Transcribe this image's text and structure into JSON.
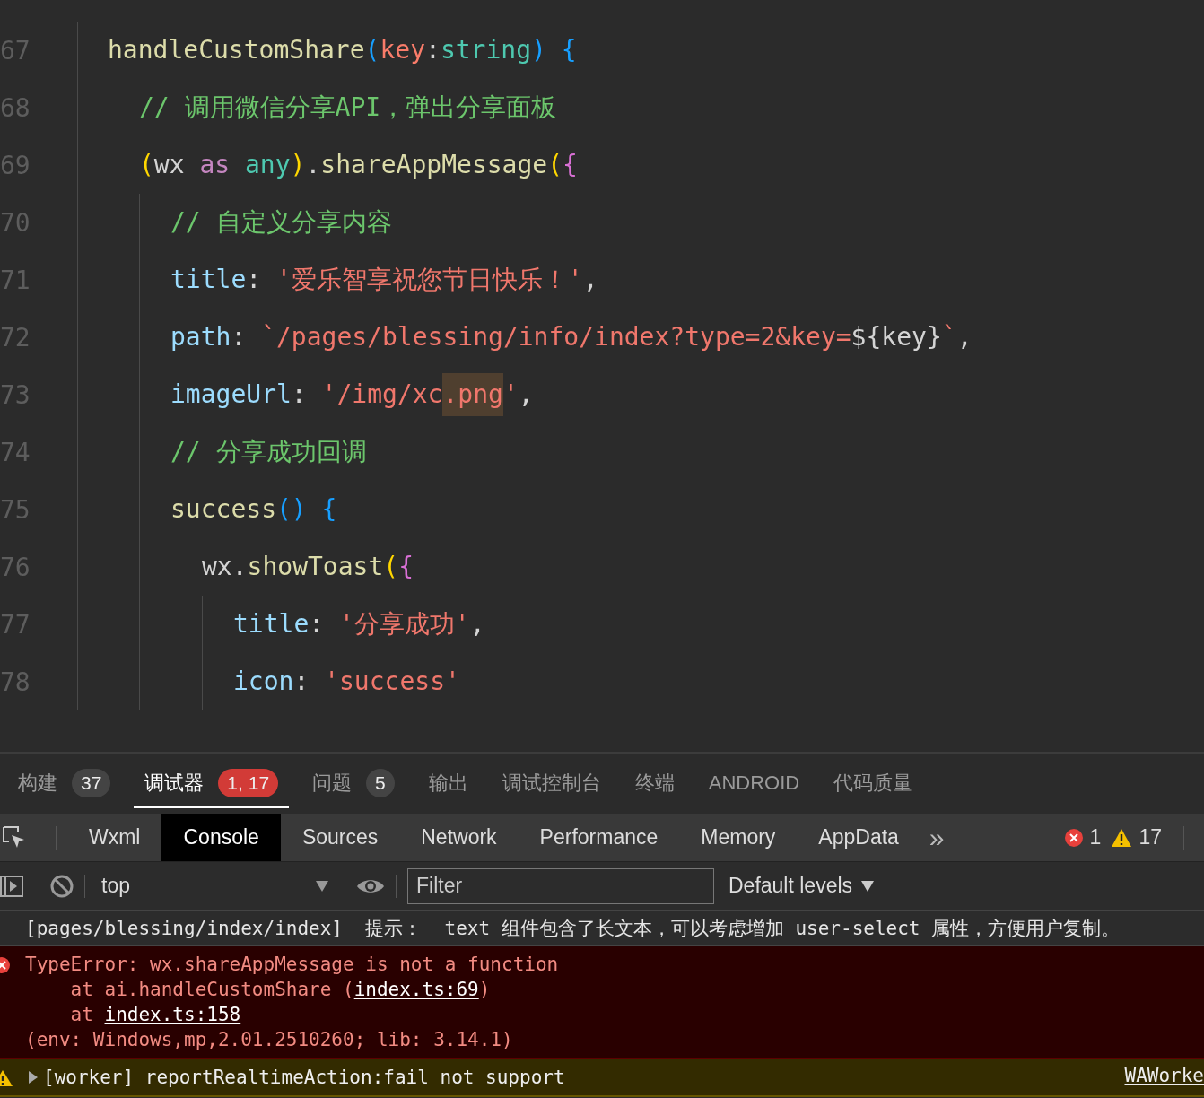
{
  "editor": {
    "lines": [
      {
        "number": "67",
        "tokens": [
          {
            "text": "handleCustomShare",
            "kind": "fn"
          },
          {
            "text": "(",
            "kind": "bracket3"
          },
          {
            "text": "key",
            "kind": "param"
          },
          {
            "text": ":",
            "kind": "plain"
          },
          {
            "text": "string",
            "kind": "type"
          },
          {
            "text": ")",
            "kind": "bracket3"
          },
          {
            "text": " {",
            "kind": "bracket3"
          }
        ],
        "children": [
          {
            "number": "68",
            "tokens": [
              {
                "text": "// 调用微信分享API，弹出分享面板",
                "kind": "comment"
              }
            ]
          },
          {
            "number": "69",
            "tokens": [
              {
                "text": "(",
                "kind": "bracket1"
              },
              {
                "text": "wx ",
                "kind": "plain"
              },
              {
                "text": "as",
                "kind": "keyword"
              },
              {
                "text": " any",
                "kind": "type"
              },
              {
                "text": ")",
                "kind": "bracket1"
              },
              {
                "text": ".",
                "kind": "plain"
              },
              {
                "text": "shareAppMessage",
                "kind": "fn"
              },
              {
                "text": "(",
                "kind": "bracket1"
              },
              {
                "text": "{",
                "kind": "bracket2"
              }
            ],
            "children": [
              {
                "number": "70",
                "tokens": [
                  {
                    "text": "// 自定义分享内容",
                    "kind": "comment"
                  }
                ]
              },
              {
                "number": "71",
                "tokens": [
                  {
                    "text": "title",
                    "kind": "prop"
                  },
                  {
                    "text": ": ",
                    "kind": "plain"
                  },
                  {
                    "text": "'爱乐智享祝您节日快乐！'",
                    "kind": "str"
                  },
                  {
                    "text": ",",
                    "kind": "plain"
                  }
                ]
              },
              {
                "number": "72",
                "tokens": [
                  {
                    "text": "path",
                    "kind": "prop"
                  },
                  {
                    "text": ": ",
                    "kind": "plain"
                  },
                  {
                    "text": "`/pages/blessing/info/index?type=2&key=",
                    "kind": "str"
                  },
                  {
                    "text": "${key}",
                    "kind": "plain"
                  },
                  {
                    "text": "`",
                    "kind": "str"
                  },
                  {
                    "text": ",",
                    "kind": "plain"
                  }
                ]
              },
              {
                "number": "73",
                "tokens": [
                  {
                    "text": "imageUrl",
                    "kind": "prop"
                  },
                  {
                    "text": ": ",
                    "kind": "plain"
                  },
                  {
                    "text": "'/img/xc",
                    "kind": "str"
                  },
                  {
                    "text": ".png",
                    "kind": "match"
                  },
                  {
                    "text": "'",
                    "kind": "str"
                  },
                  {
                    "text": ",",
                    "kind": "plain"
                  }
                ]
              },
              {
                "number": "74",
                "tokens": [
                  {
                    "text": "// 分享成功回调",
                    "kind": "comment"
                  }
                ]
              },
              {
                "number": "75",
                "tokens": [
                  {
                    "text": "success",
                    "kind": "fn"
                  },
                  {
                    "text": "()",
                    "kind": "bracket3"
                  },
                  {
                    "text": " {",
                    "kind": "bracket3"
                  }
                ],
                "children": [
                  {
                    "number": "76",
                    "tokens": [
                      {
                        "text": "wx.",
                        "kind": "plain"
                      },
                      {
                        "text": "showToast",
                        "kind": "fn"
                      },
                      {
                        "text": "(",
                        "kind": "bracket1"
                      },
                      {
                        "text": "{",
                        "kind": "bracket2"
                      }
                    ],
                    "children": [
                      {
                        "number": "77",
                        "tokens": [
                          {
                            "text": "title",
                            "kind": "prop"
                          },
                          {
                            "text": ": ",
                            "kind": "plain"
                          },
                          {
                            "text": "'分享成功'",
                            "kind": "str"
                          },
                          {
                            "text": ",",
                            "kind": "plain"
                          }
                        ]
                      },
                      {
                        "number": "78",
                        "tokens": [
                          {
                            "text": "icon",
                            "kind": "prop"
                          },
                          {
                            "text": ": ",
                            "kind": "plain"
                          },
                          {
                            "text": "'success'",
                            "kind": "str"
                          }
                        ]
                      }
                    ]
                  }
                ]
              }
            ]
          }
        ]
      }
    ]
  },
  "panel_tabs": [
    {
      "label": "构建",
      "badge": "37",
      "color": "#444444",
      "selected": false
    },
    {
      "label": "调试器",
      "badge": "1, 17",
      "color": "#d23b37",
      "selected": true
    },
    {
      "label": "问题",
      "badge": "5",
      "color": "#444444",
      "selected": false
    },
    {
      "label": "输出",
      "selected": false
    },
    {
      "label": "调试控制台",
      "selected": false
    },
    {
      "label": "终端",
      "selected": false
    },
    {
      "label": "ANDROID",
      "selected": false
    },
    {
      "label": "代码质量",
      "selected": false
    }
  ],
  "devtools_tabs": [
    {
      "label": "Wxml",
      "selected": false
    },
    {
      "label": "Console",
      "selected": true
    },
    {
      "label": "Sources",
      "selected": false
    },
    {
      "label": "Network",
      "selected": false
    },
    {
      "label": "Performance",
      "selected": false
    },
    {
      "label": "Memory",
      "selected": false
    },
    {
      "label": "AppData",
      "selected": false
    }
  ],
  "more_tabs": "»",
  "counts": {
    "errors": "1",
    "warnings": "17"
  },
  "console_toolbar": {
    "context": "top",
    "filter": {
      "placeholder": "Filter"
    },
    "levels": "Default levels"
  },
  "messages": [
    {
      "kind": "info",
      "lines": [
        [
          {
            "text": "[pages/blessing/index/index]  提示：  text 组件包含了长文本，可以考虑增加 user-select 属性，方便用户复制。",
            "kind": "text"
          }
        ]
      ]
    },
    {
      "kind": "error",
      "lines": [
        [
          {
            "text": "TypeError: wx.shareAppMessage is not a function",
            "kind": "text"
          }
        ],
        [
          {
            "text": "    at ai.handleCustomShare (",
            "kind": "text"
          },
          {
            "text": "index.ts:69",
            "kind": "link"
          },
          {
            "text": ")",
            "kind": "text"
          }
        ],
        [
          {
            "text": "    at ",
            "kind": "text"
          },
          {
            "text": "index.ts:158",
            "kind": "link"
          }
        ],
        [
          {
            "text": "(env: Windows,mp,2.01.2510260; lib: 3.14.1)",
            "kind": "text"
          }
        ]
      ]
    },
    {
      "kind": "warning",
      "lines": [
        [
          {
            "text": "[worker] reportRealtimeAction:fail not support",
            "kind": "text"
          }
        ]
      ],
      "source": "WAWorke"
    }
  ]
}
